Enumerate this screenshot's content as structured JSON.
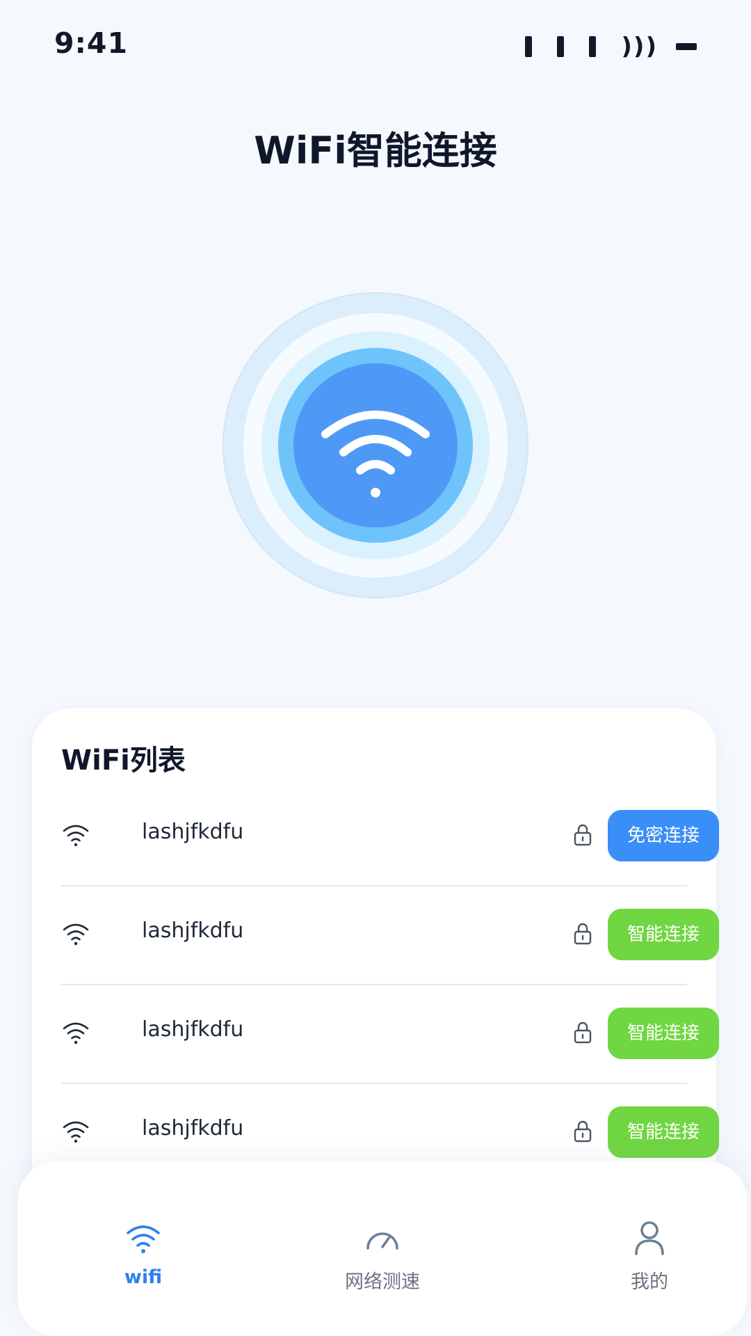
{
  "status_bar": {
    "time": "9:41",
    "wifi_glyph": ")))"
  },
  "title": "WiFi智能连接",
  "hero": {
    "icon": "wifi-icon",
    "colors": {
      "outer": "#dcedfb",
      "ring_light": "#d9f2fe",
      "ring_mid": "#6ec3fb",
      "core": "#4f99f6"
    }
  },
  "wifi_list": {
    "title": "WiFi列表",
    "items": [
      {
        "name": "lashjfkdfu",
        "action": "免密连接",
        "action_color": "#3a8ef7",
        "locked": true
      },
      {
        "name": "lashjfkdfu",
        "action": "智能连接",
        "action_color": "#70d641",
        "locked": true
      },
      {
        "name": "lashjfkdfu",
        "action": "智能连接",
        "action_color": "#70d641",
        "locked": true
      },
      {
        "name": "lashjfkdfu",
        "action": "智能连接",
        "action_color": "#70d641",
        "locked": true
      }
    ]
  },
  "bottom_nav": {
    "items": [
      {
        "label": "wifi",
        "icon": "wifi-icon",
        "active": true
      },
      {
        "label": "网络测速",
        "icon": "speedometer-icon",
        "active": false
      },
      {
        "label": "我的",
        "icon": "user-icon",
        "active": false
      }
    ],
    "active_color": "#2f80ed",
    "inactive_color": "#6b7280"
  }
}
